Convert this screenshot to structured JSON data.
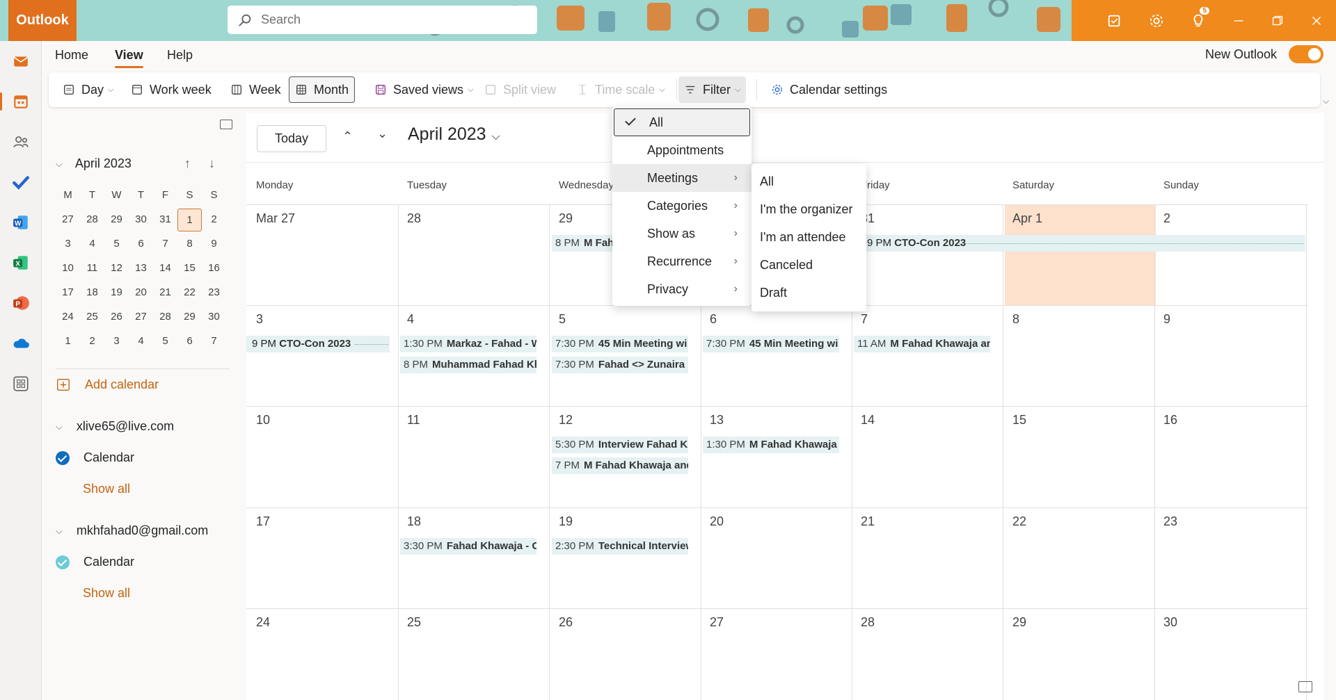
{
  "app": {
    "name": "Outlook"
  },
  "search": {
    "placeholder": "Search"
  },
  "titlebar": {
    "notification_count": "5",
    "accent": "#e1701e"
  },
  "menu": {
    "tabs": [
      "Home",
      "View",
      "Help"
    ],
    "active": "View",
    "new_outlook": "New Outlook"
  },
  "ribbon": {
    "day": "Day",
    "work_week": "Work week",
    "week": "Week",
    "month": "Month",
    "saved_views": "Saved views",
    "split_view": "Split view",
    "time_scale": "Time scale",
    "filter": "Filter",
    "calendar_settings": "Calendar settings"
  },
  "mini_calendar": {
    "title": "April 2023",
    "weekday_headers": [
      "M",
      "T",
      "W",
      "T",
      "F",
      "S",
      "S"
    ],
    "weeks": [
      [
        "27",
        "28",
        "29",
        "30",
        "31",
        "1",
        "2"
      ],
      [
        "3",
        "4",
        "5",
        "6",
        "7",
        "8",
        "9"
      ],
      [
        "10",
        "11",
        "12",
        "13",
        "14",
        "15",
        "16"
      ],
      [
        "17",
        "18",
        "19",
        "20",
        "21",
        "22",
        "23"
      ],
      [
        "24",
        "25",
        "26",
        "27",
        "28",
        "29",
        "30"
      ],
      [
        "1",
        "2",
        "3",
        "4",
        "5",
        "6",
        "7"
      ]
    ],
    "today": "1"
  },
  "sidebar": {
    "add_calendar": "Add calendar",
    "accounts": [
      {
        "email": "xlive65@live.com",
        "calendar": "Calendar",
        "show_all": "Show all",
        "color": "#0f6cbd"
      },
      {
        "email": "mkhfahad0@gmail.com",
        "calendar": "Calendar",
        "show_all": "Show all",
        "color": "#6ccbd6"
      }
    ]
  },
  "calendar": {
    "today_label": "Today",
    "title": "April 2023",
    "weekdays": [
      "Monday",
      "Tuesday",
      "Wednesday",
      "Thursday",
      "Friday",
      "Saturday",
      "Sunday"
    ],
    "weeks": [
      [
        "Mar 27",
        "28",
        "29",
        "30",
        "31",
        "Apr 1",
        "2"
      ],
      [
        "3",
        "4",
        "5",
        "6",
        "7",
        "8",
        "9"
      ],
      [
        "10",
        "11",
        "12",
        "13",
        "14",
        "15",
        "16"
      ],
      [
        "17",
        "18",
        "19",
        "20",
        "21",
        "22",
        "23"
      ],
      [
        "24",
        "25",
        "26",
        "27",
        "28",
        "29",
        "30"
      ]
    ],
    "events": [
      {
        "time": "8 PM",
        "name": "M Fahad"
      },
      {
        "time": "9 PM",
        "name": "CTO-Con 2023"
      },
      {
        "time": "9 PM",
        "name": "CTO-Con 2023"
      },
      {
        "time": "1:30 PM",
        "name": "Markaz - Fahad - W"
      },
      {
        "time": "8 PM",
        "name": "Muhammad Fahad Kh"
      },
      {
        "time": "7:30 PM",
        "name": "45 Min Meeting wi"
      },
      {
        "time": "7:30 PM",
        "name": "Fahad <> Zunaira"
      },
      {
        "time": "7:30 PM",
        "name": "45 Min Meeting wi"
      },
      {
        "time": "11 AM",
        "name": "M Fahad Khawaja an"
      },
      {
        "time": "5:30 PM",
        "name": "Interview Fahad Kh"
      },
      {
        "time": "7 PM",
        "name": "M Fahad Khawaja and"
      },
      {
        "time": "1:30 PM",
        "name": "M Fahad Khawaja a"
      },
      {
        "time": "3:30 PM",
        "name": "Fahad Khawaja - O"
      },
      {
        "time": "2:30 PM",
        "name": "Technical Interview"
      }
    ]
  },
  "filter_menu": {
    "items": [
      "All",
      "Appointments",
      "Meetings",
      "Categories",
      "Show as",
      "Recurrence",
      "Privacy"
    ],
    "checked": "All",
    "highlighted": "Meetings",
    "meetings_submenu": [
      "All",
      "I'm the organizer",
      "I'm an attendee",
      "Canceled",
      "Draft"
    ]
  }
}
